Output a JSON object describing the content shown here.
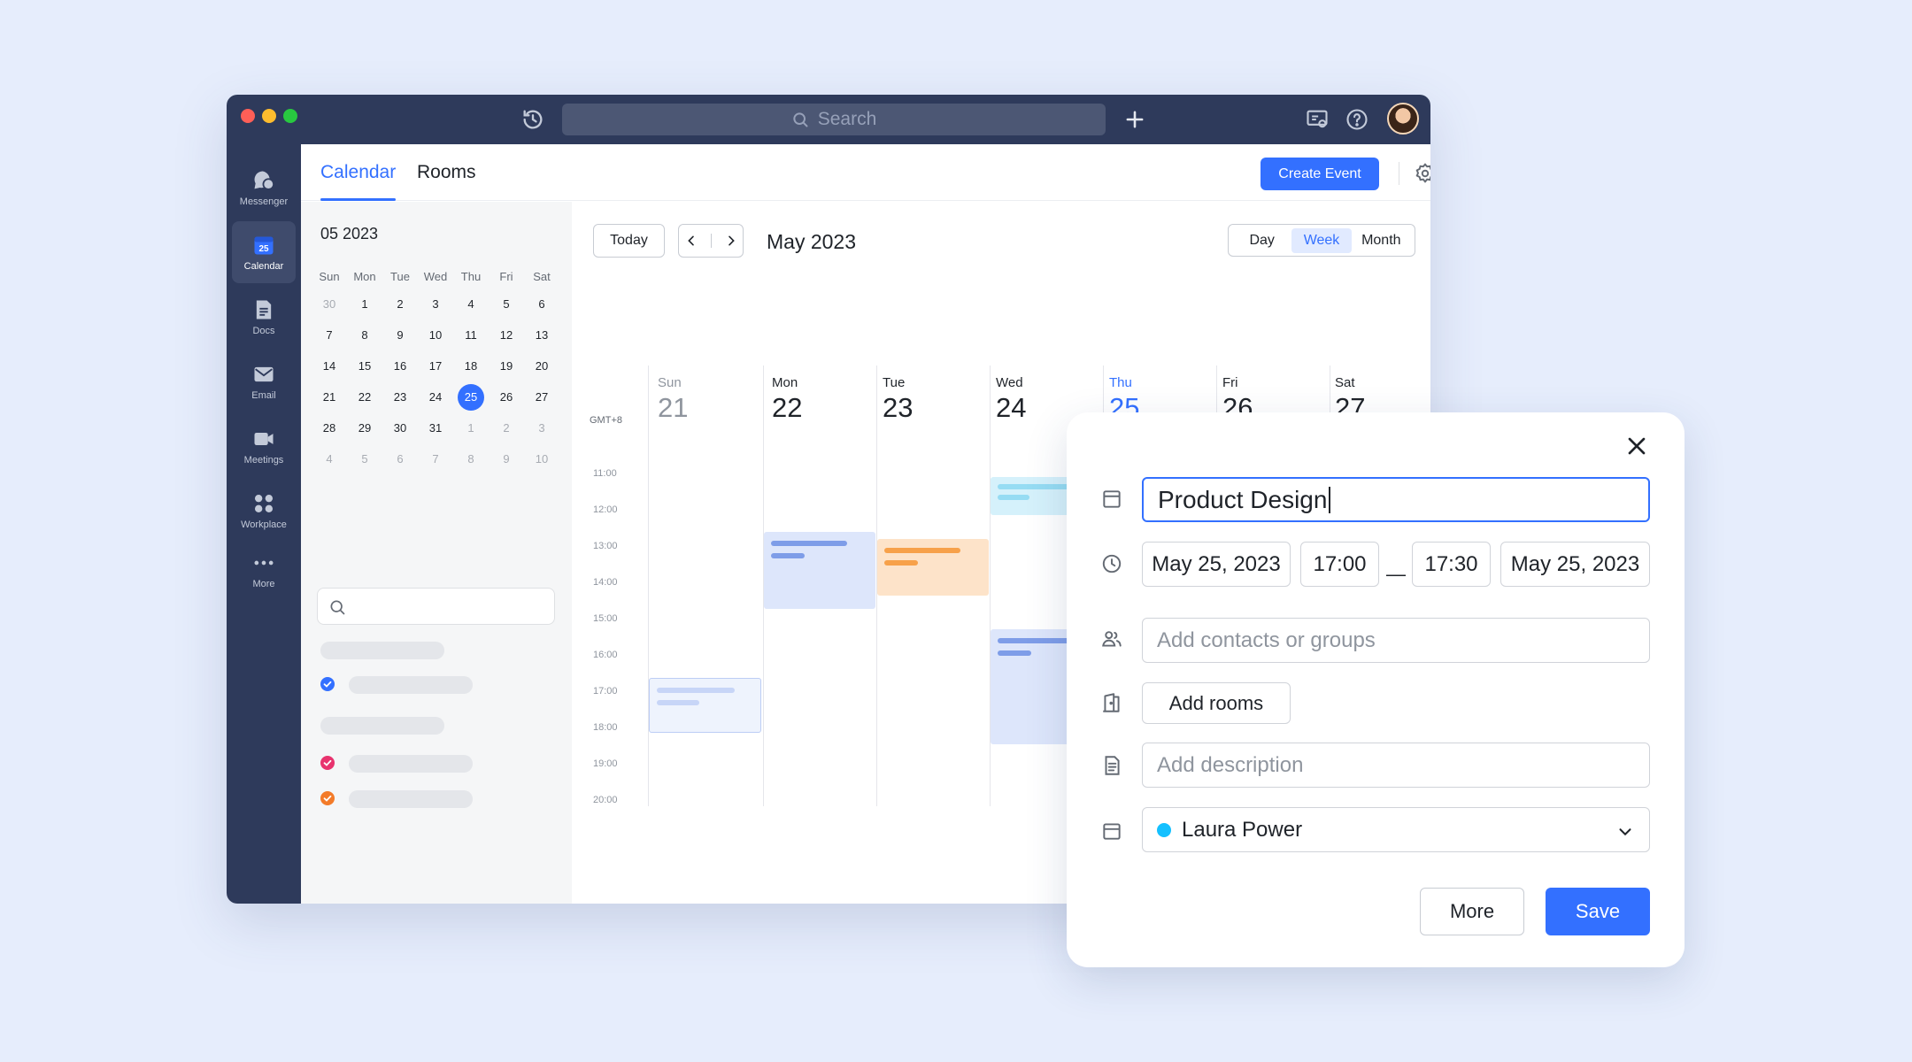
{
  "colors": {
    "accent": "#3370ff",
    "rail_bg": "#2e3a5b",
    "page_bg": "#e6edfc",
    "event_blue": "#dde6fb",
    "event_orange": "#fde3c9",
    "event_cyan": "#d5f1fb",
    "check_blue": "#3370ff",
    "check_pink": "#e8336e",
    "check_orange": "#f37b29"
  },
  "titlebar": {
    "search_placeholder": "Search"
  },
  "rail": {
    "items": [
      {
        "label": "Messenger",
        "icon": "messenger-icon"
      },
      {
        "label": "Calendar",
        "icon": "calendar-icon",
        "badge": "25",
        "active": true
      },
      {
        "label": "Docs",
        "icon": "docs-icon"
      },
      {
        "label": "Email",
        "icon": "email-icon"
      },
      {
        "label": "Meetings",
        "icon": "video-icon"
      },
      {
        "label": "Workplace",
        "icon": "workplace-icon"
      },
      {
        "label": "More",
        "icon": "more-icon"
      }
    ]
  },
  "header": {
    "tabs": [
      {
        "label": "Calendar",
        "active": true
      },
      {
        "label": "Rooms",
        "active": false
      }
    ],
    "create_label": "Create Event"
  },
  "mini_calendar": {
    "title": "05 2023",
    "weekdays": [
      "Sun",
      "Mon",
      "Tue",
      "Wed",
      "Thu",
      "Fri",
      "Sat"
    ],
    "weeks": [
      [
        "30",
        "1",
        "2",
        "3",
        "4",
        "5",
        "6"
      ],
      [
        "7",
        "8",
        "9",
        "10",
        "11",
        "12",
        "13"
      ],
      [
        "14",
        "15",
        "16",
        "17",
        "18",
        "19",
        "20"
      ],
      [
        "21",
        "22",
        "23",
        "24",
        "25",
        "26",
        "27"
      ],
      [
        "28",
        "29",
        "30",
        "31",
        "1",
        "2",
        "3"
      ],
      [
        "4",
        "5",
        "6",
        "7",
        "8",
        "9",
        "10"
      ]
    ],
    "today": "25"
  },
  "toolbar": {
    "today_label": "Today",
    "month_title": "May 2023",
    "views": [
      {
        "label": "Day",
        "active": false
      },
      {
        "label": "Week",
        "active": true
      },
      {
        "label": "Month",
        "active": false
      }
    ]
  },
  "week": {
    "timezone": "GMT+8",
    "hours": [
      "11:00",
      "12:00",
      "13:00",
      "14:00",
      "15:00",
      "16:00",
      "17:00",
      "18:00",
      "19:00",
      "20:00"
    ],
    "days": [
      {
        "name": "Sun",
        "num": "21"
      },
      {
        "name": "Mon",
        "num": "22"
      },
      {
        "name": "Tue",
        "num": "23"
      },
      {
        "name": "Wed",
        "num": "24"
      },
      {
        "name": "Thu",
        "num": "25"
      },
      {
        "name": "Fri",
        "num": "26"
      },
      {
        "name": "Sat",
        "num": "27"
      }
    ]
  },
  "dialog": {
    "title_value": "Product Design",
    "start_date": "May 25, 2023",
    "start_time": "17:00",
    "separator": "—",
    "end_time": "17:30",
    "end_date": "May 25, 2023",
    "contacts_placeholder": "Add contacts or groups",
    "rooms_label": "Add rooms",
    "description_placeholder": "Add description",
    "calendar_owner": "Laura Power",
    "more_label": "More",
    "save_label": "Save"
  }
}
